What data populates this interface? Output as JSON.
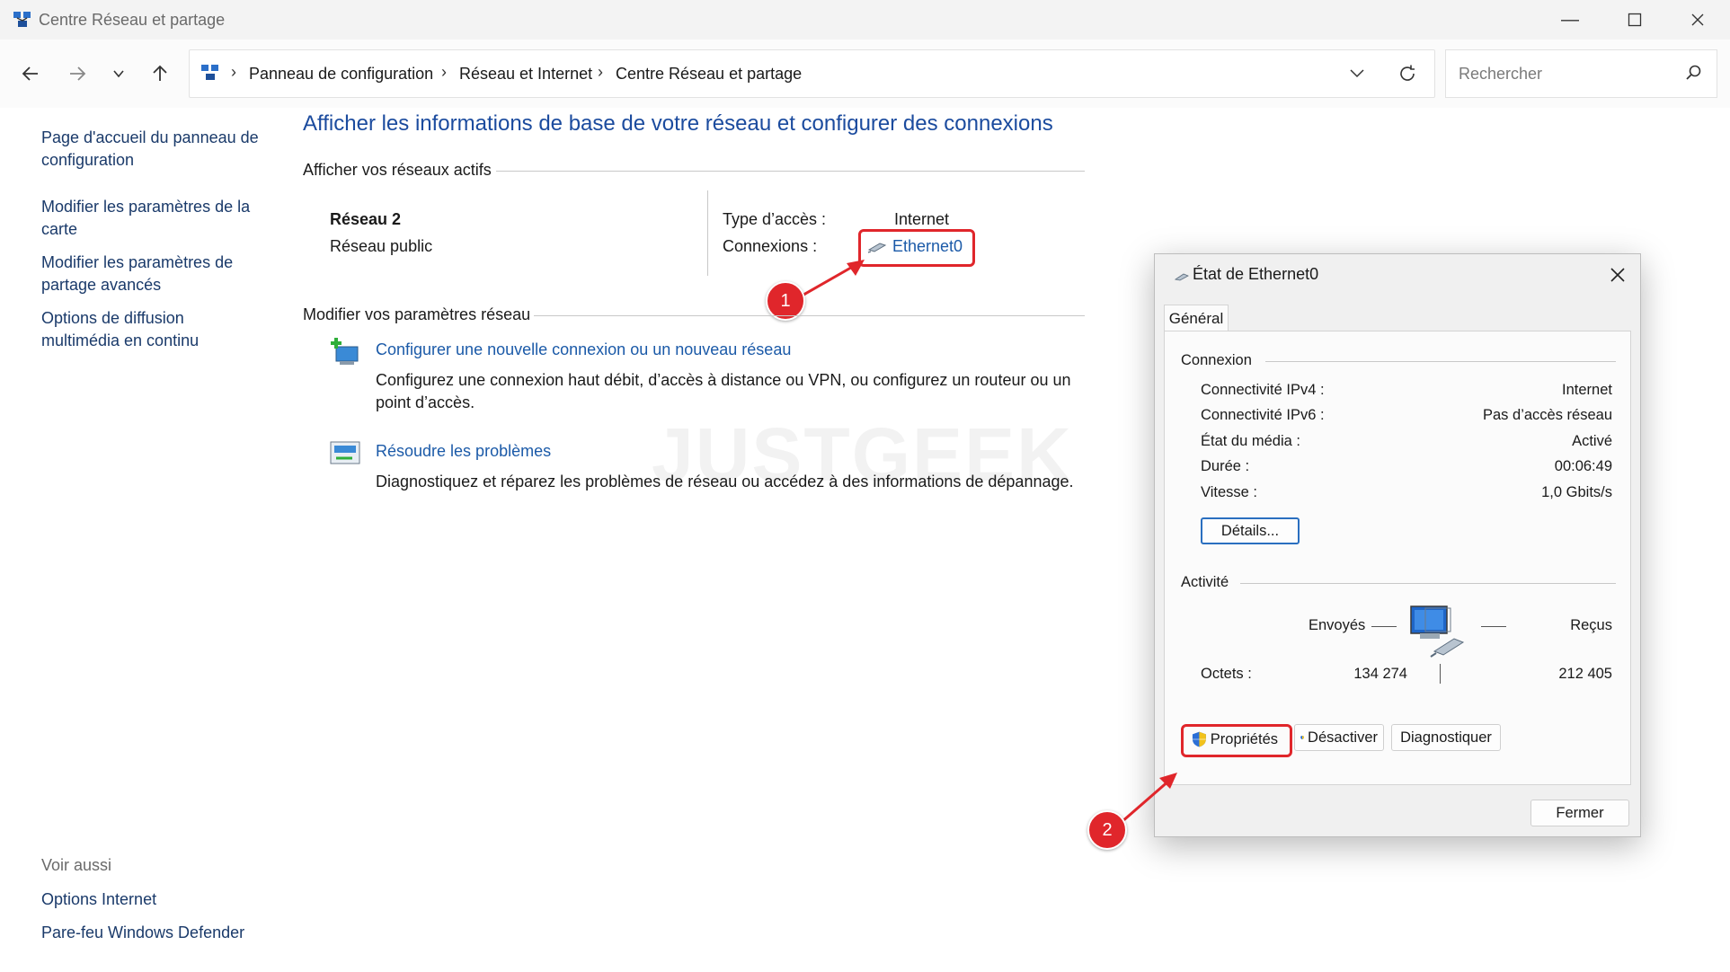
{
  "window": {
    "title": "Centre Réseau et partage"
  },
  "breadcrumb": [
    "Panneau de configuration",
    "Réseau et Internet",
    "Centre Réseau et partage"
  ],
  "search": {
    "placeholder": "Rechercher"
  },
  "sidebar": {
    "links": [
      "Page d'accueil du panneau de configuration",
      "Modifier les paramètres de la carte",
      "Modifier les paramètres de partage avancés",
      "Options de diffusion multimédia en continu"
    ],
    "see_also_label": "Voir aussi",
    "see_also": [
      "Options Internet",
      "Pare-feu Windows Defender"
    ]
  },
  "main": {
    "heading": "Afficher les informations de base de votre réseau et configurer des connexions",
    "active_networks_label": "Afficher vos réseaux actifs",
    "network": {
      "name": "Réseau 2",
      "profile": "Réseau public",
      "access_type_label": "Type d’accès :",
      "access_type": "Internet",
      "connections_label": "Connexions :",
      "connection": "Ethernet0"
    },
    "change_settings_label": "Modifier vos paramètres réseau",
    "tasks": [
      {
        "title": "Configurer une nouvelle connexion ou un nouveau réseau",
        "desc_line1": "Configurez une connexion haut débit, d’accès à distance ou VPN, ou configurez un routeur ou un",
        "desc_line2": "point d’accès."
      },
      {
        "title": "Résoudre les problèmes",
        "desc_line1": "Diagnostiquez et réparez les problèmes de réseau ou accédez à des informations de dépannage."
      }
    ],
    "watermark": "JUSTGEEK"
  },
  "annotations": {
    "step1": "1",
    "step2": "2",
    "accent_color": "#e0262b"
  },
  "dialog": {
    "title": "État de Ethernet0",
    "tab": "Général",
    "connection_label": "Connexion",
    "rows": [
      {
        "label": "Connectivité IPv4 :",
        "value": "Internet"
      },
      {
        "label": "Connectivité IPv6 :",
        "value": "Pas d’accès réseau"
      },
      {
        "label": "État du média :",
        "value": "Activé"
      },
      {
        "label": "Durée :",
        "value": "00:06:49"
      },
      {
        "label": "Vitesse :",
        "value": "1,0 Gbits/s"
      }
    ],
    "details_button": "Détails...",
    "activity_label": "Activité",
    "sent_label": "Envoyés",
    "received_label": "Reçus",
    "bytes_label": "Octets :",
    "bytes_sent": "134 274",
    "bytes_received": "212 405",
    "properties_button": "Propriétés",
    "disable_button": "Désactiver",
    "diagnose_button": "Diagnostiquer",
    "close_button": "Fermer"
  }
}
